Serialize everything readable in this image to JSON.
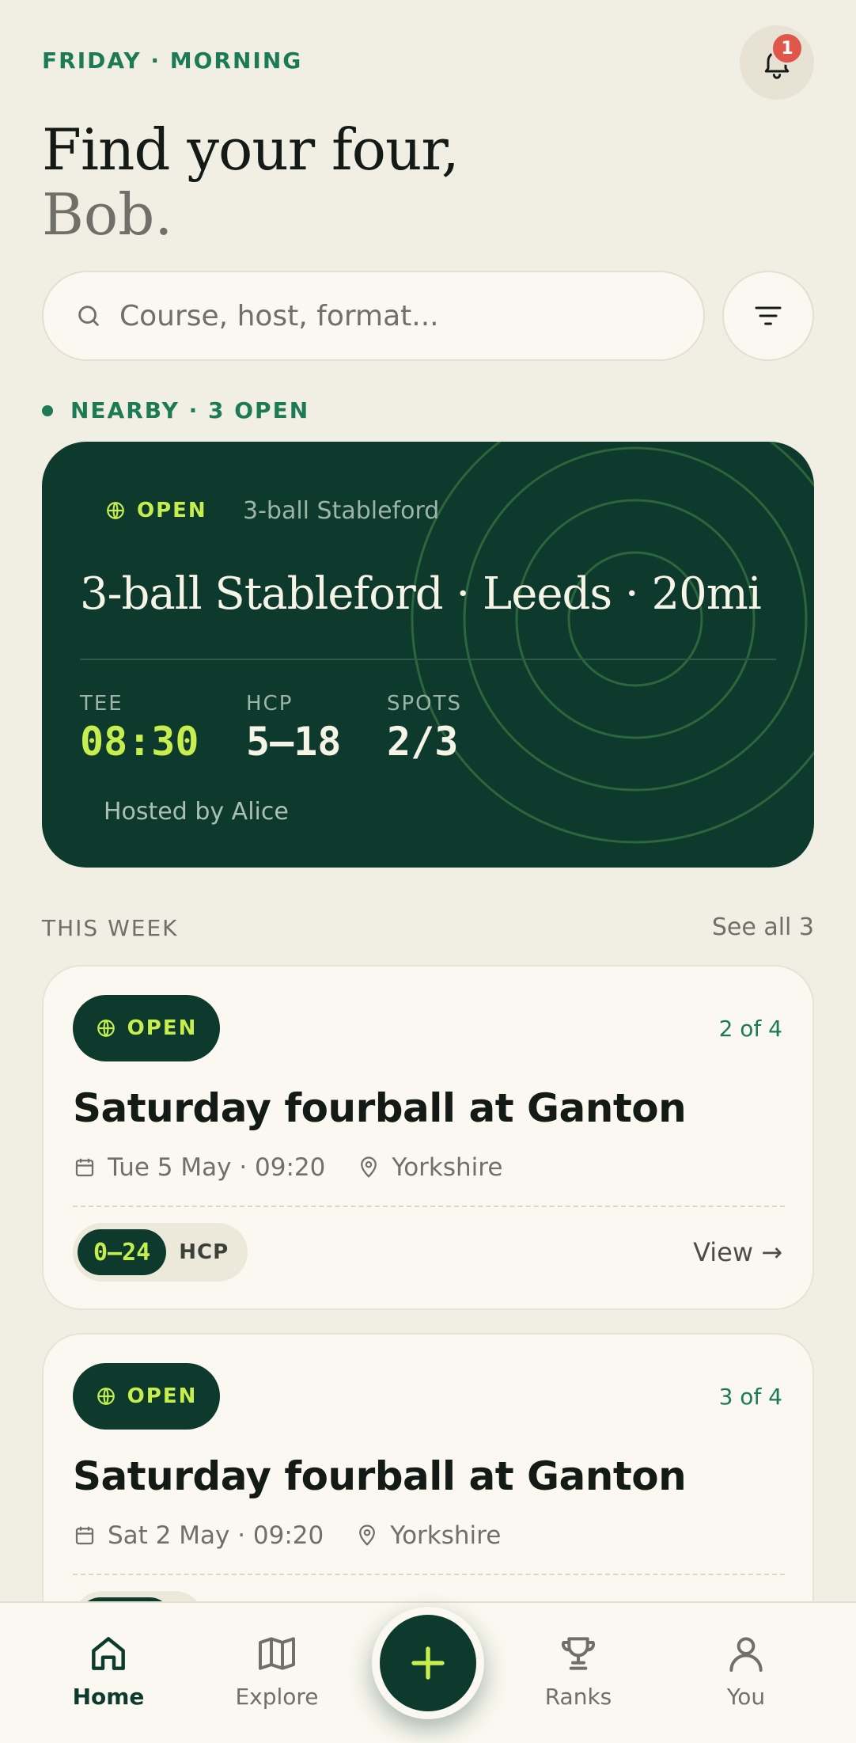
{
  "header": {
    "day": "FRIDAY · MORNING",
    "notifications_count": "1",
    "greeting_line1": "Find your four,",
    "greeting_line2": "Bob."
  },
  "search": {
    "placeholder": "Course, host, format..."
  },
  "nearby": {
    "label": "NEARBY · 3 OPEN"
  },
  "featured": {
    "status": "OPEN",
    "format": "3-ball Stableford",
    "title": "3-ball Stableford · Leeds · 20mi",
    "tee_label": "TEE",
    "tee_value": "08:30",
    "hcp_label": "HCP",
    "hcp_value": "5–18",
    "spots_label": "SPOTS",
    "spots_value": "2/3",
    "host": "Hosted by Alice"
  },
  "this_week": {
    "title": "THIS WEEK",
    "see_all": "See all 3",
    "items": [
      {
        "status": "OPEN",
        "count": "2 of 4",
        "title": "Saturday fourball at Ganton",
        "date": "Tue 5 May · 09:20",
        "location": "Yorkshire",
        "hcp_range": "0–24",
        "hcp_label": "HCP",
        "view": "View →"
      },
      {
        "status": "OPEN",
        "count": "3 of 4",
        "title": "Saturday fourball at Ganton",
        "date": "Sat 2 May · 09:20",
        "location": "Yorkshire",
        "hcp_range": "",
        "hcp_label": "",
        "view": ""
      }
    ]
  },
  "nav": {
    "items": [
      {
        "label": "Home",
        "icon": "home-icon",
        "active": true
      },
      {
        "label": "Explore",
        "icon": "map-icon",
        "active": false
      },
      {
        "label": "Ranks",
        "icon": "trophy-icon",
        "active": false
      },
      {
        "label": "You",
        "icon": "user-icon",
        "active": false
      }
    ],
    "fab_icon": "plus-icon"
  },
  "colors": {
    "background": "#f1eee3",
    "brand_dark": "#0d3a2c",
    "accent_lime": "#c6ee4f",
    "accent_green": "#1c7a55",
    "badge_red": "#e0564a"
  }
}
